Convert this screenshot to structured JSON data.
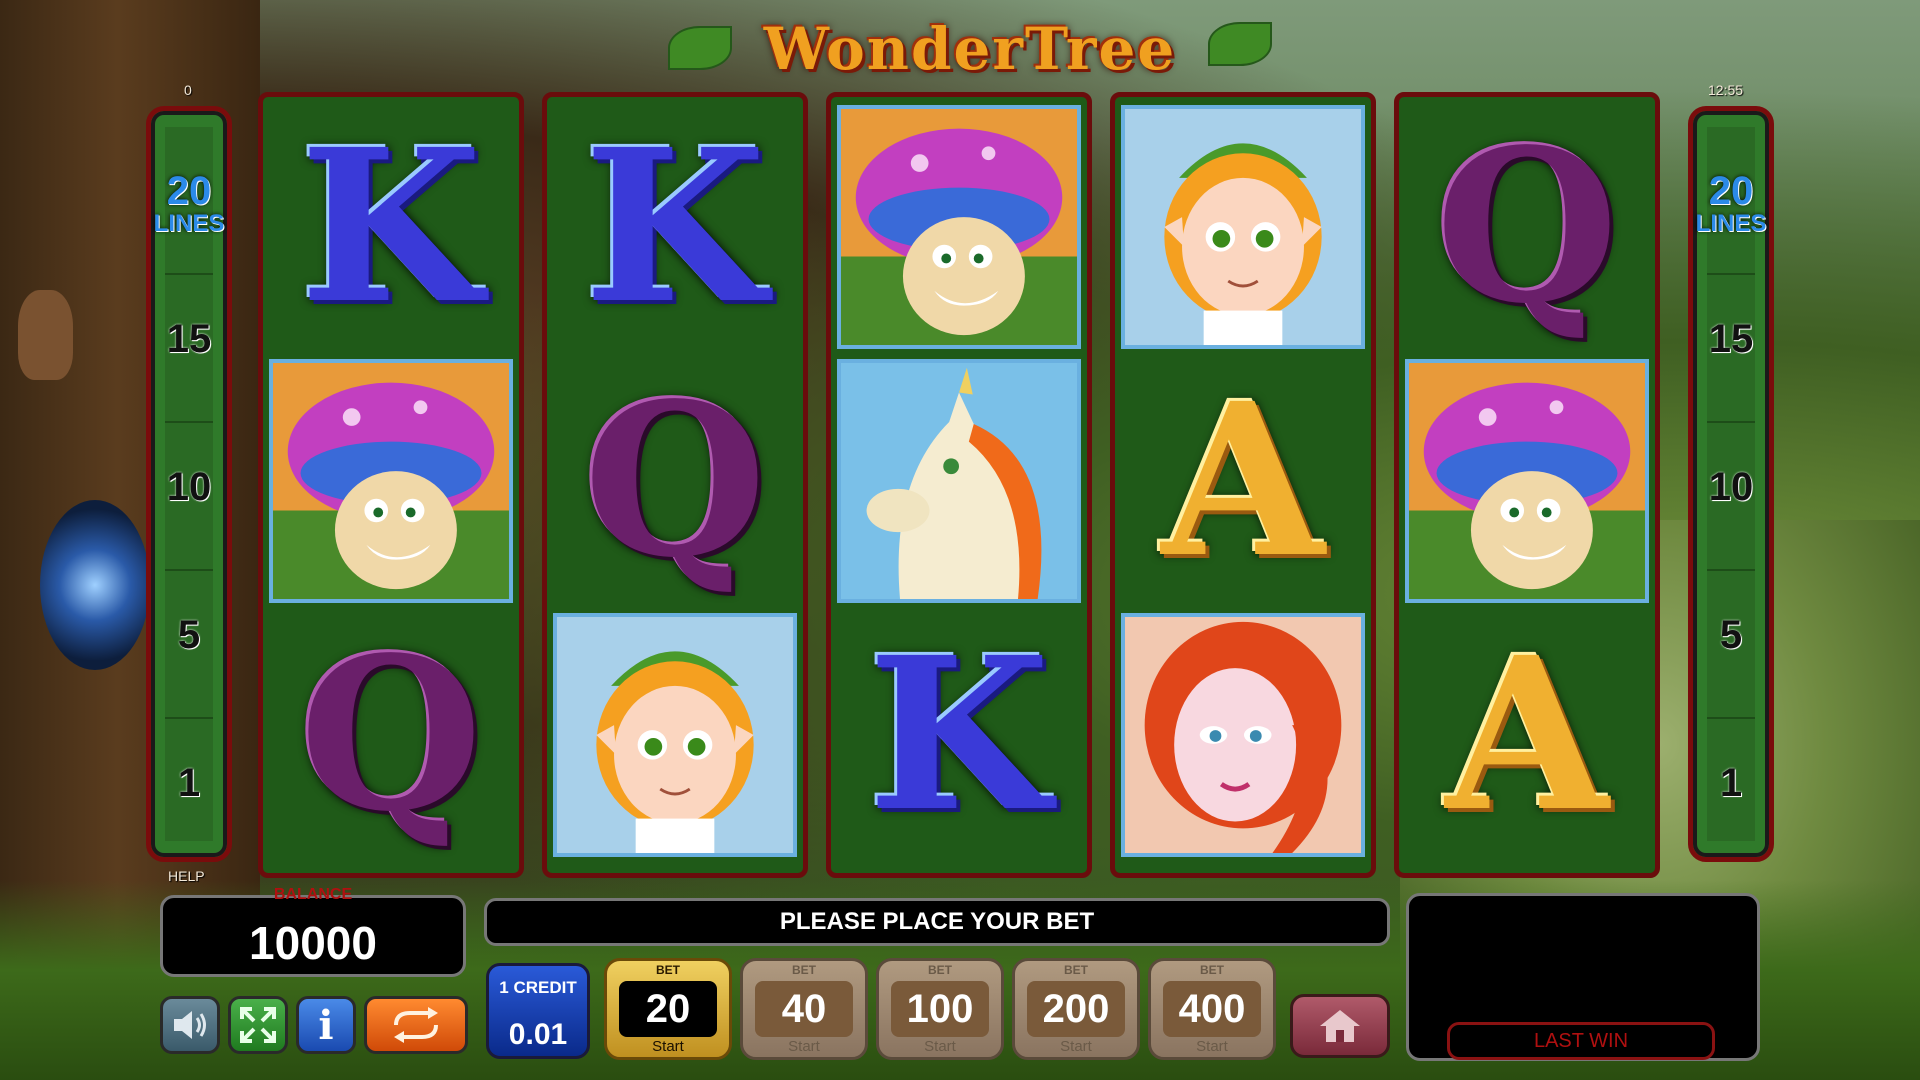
{
  "game": {
    "title": "WonderTree",
    "top_left_counter": "0",
    "clock": "12:55",
    "help_label": "HELP"
  },
  "paylines": {
    "lines_count": "20",
    "lines_label": "LINES",
    "markers": [
      "15",
      "10",
      "5",
      "1"
    ]
  },
  "reels": [
    [
      "K",
      "mushroom",
      "Q"
    ],
    [
      "K",
      "Q",
      "elf-boy"
    ],
    [
      "mushroom",
      "unicorn",
      "K"
    ],
    [
      "elf-boy",
      "A",
      "red-haired-fairy"
    ],
    [
      "Q",
      "mushroom",
      "A"
    ]
  ],
  "balance": {
    "label": "BALANCE",
    "value": "10000"
  },
  "message": "PLEASE PLACE YOUR BET",
  "last_win": {
    "label": "LAST WIN",
    "value": ""
  },
  "credit": {
    "label": "1 CREDIT",
    "value": "0.01"
  },
  "bets": [
    {
      "top": "BET",
      "value": "20",
      "start": "Start",
      "active": true
    },
    {
      "top": "BET",
      "value": "40",
      "start": "Start",
      "active": false
    },
    {
      "top": "BET",
      "value": "100",
      "start": "Start",
      "active": false
    },
    {
      "top": "BET",
      "value": "200",
      "start": "Start",
      "active": false
    },
    {
      "top": "BET",
      "value": "400",
      "start": "Start",
      "active": false
    }
  ],
  "controls": {
    "sound_icon": "speaker-icon",
    "fullscreen_icon": "fullscreen-icon",
    "info_icon": "info-icon",
    "info_glyph": "i",
    "autoplay_icon": "autoplay-icon",
    "home_icon": "home-icon"
  },
  "colors": {
    "reel_bg": "#1f5a18",
    "reel_border": "#6a0c0c",
    "active_bet": "#e0b840",
    "credit_blue": "#1a4ad0",
    "lines_blue": "#2b8ae8",
    "last_win_red": "#b01010"
  }
}
